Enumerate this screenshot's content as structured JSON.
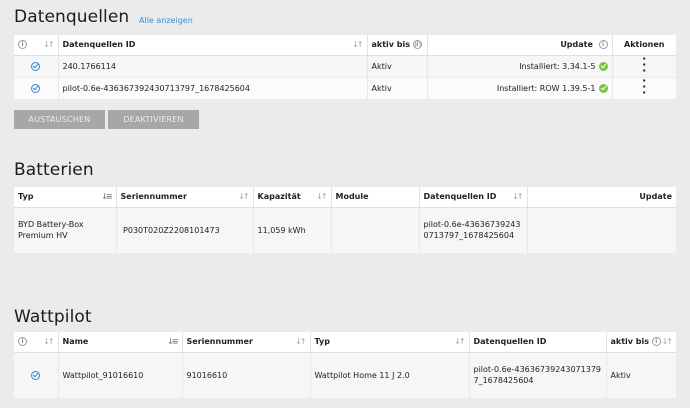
{
  "datenquellen": {
    "title": "Datenquellen",
    "show_all": "Alle anzeigen",
    "headers": {
      "id": "Datenquellen ID",
      "active": "aktiv bis",
      "update": "Update",
      "actions": "Aktionen"
    },
    "rows": [
      {
        "id": "240.1766114",
        "active": "Aktiv",
        "update": "Installiert: 3.34.1-5"
      },
      {
        "id": "pilot-0.6e-436367392430713797_1678425604",
        "active": "Aktiv",
        "update": "Installiert: ROW 1.39.5-1"
      }
    ],
    "buttons": {
      "replace": "AUSTAUSCHEN",
      "deactivate": "DEAKTIVIEREN"
    }
  },
  "batterien": {
    "title": "Batterien",
    "headers": {
      "type": "Typ",
      "serial": "Seriennummer",
      "capacity": "Kapazität",
      "module": "Module",
      "source": "Datenquellen ID",
      "update": "Update"
    },
    "rows": [
      {
        "type": "BYD Battery-Box Premium HV",
        "serial": "P030T020Z2208101473",
        "capacity": "11,059 kWh",
        "module": "",
        "source": "pilot-0.6e-436367392430713797_1678425604",
        "update": ""
      }
    ]
  },
  "wattpilot": {
    "title": "Wattpilot",
    "headers": {
      "name": "Name",
      "serial": "Seriennummer",
      "type": "Typ",
      "source": "Datenquellen ID",
      "active": "aktiv bis"
    },
    "rows": [
      {
        "name": "Wattpilot_91016610",
        "serial": "91016610",
        "type": "Wattpilot Home 11 J 2.0",
        "source": "pilot-0.6e-436367392430713797_1678425604",
        "active": "Aktiv"
      }
    ]
  },
  "icons": {
    "info": "info-icon",
    "check": "check-circle-icon",
    "ok": "ok-status-icon",
    "sort": "sort-icon",
    "menu": "more-vertical-icon"
  },
  "colors": {
    "accent": "#2e86d6",
    "success": "#7cc24a",
    "button": "#a7a7a7"
  }
}
